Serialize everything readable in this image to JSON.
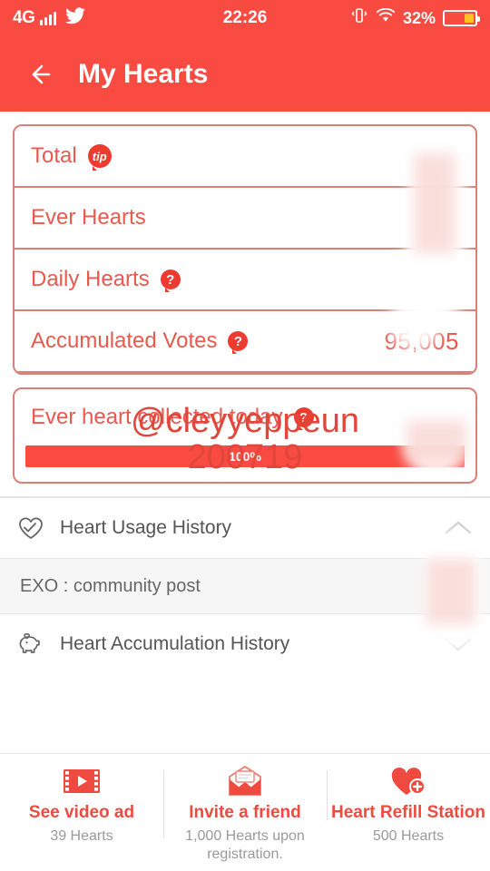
{
  "statusbar": {
    "network": "4G",
    "signal_icon": "signal-bars-icon",
    "app_icon": "twitter-bird-icon",
    "time": "22:26",
    "vibrate_icon": "vibrate-icon",
    "wifi_icon": "wifi-icon",
    "battery_percent": "32%",
    "battery_level": 32,
    "battery_color": "#ffc324"
  },
  "appbar": {
    "back_icon": "back-arrow-icon",
    "title": "My Hearts",
    "background": "#f94b41"
  },
  "summary_card": {
    "rows": [
      {
        "label": "Total",
        "badge": "tip",
        "badge_text": "tip",
        "value": ""
      },
      {
        "label": "Ever Hearts",
        "badge": "",
        "badge_text": "",
        "value": ""
      },
      {
        "label": "Daily Hearts",
        "badge": "q",
        "badge_text": "?",
        "value": ""
      },
      {
        "label": "Accumulated Votes",
        "badge": "q",
        "badge_text": "?",
        "value": "95,005"
      }
    ]
  },
  "today_card": {
    "label": "Ever heart collected today",
    "badge_text": "?",
    "value": "",
    "progress_label": "100%",
    "progress_percent": 100,
    "progress_color": "#f94b41"
  },
  "history": {
    "usage": {
      "icon": "heart-check-icon",
      "label": "Heart Usage History",
      "chevron": "chevron-up-icon",
      "expanded": true,
      "items": [
        "EXO : community post"
      ]
    },
    "accumulation": {
      "icon": "piggy-bank-heart-icon",
      "label": "Heart Accumulation History",
      "chevron": "chevron-down-icon",
      "expanded": false
    }
  },
  "bottombar": {
    "items": [
      {
        "icon": "video-ad-icon",
        "title": "See video ad",
        "sub": "39 Hearts"
      },
      {
        "icon": "envelope-icon",
        "title": "Invite a friend",
        "sub": "1,000 Hearts upon registration."
      },
      {
        "icon": "heart-plus-icon",
        "title": "Heart Refill Station",
        "sub": "500 Hearts"
      }
    ]
  },
  "watermark": {
    "line1": "@cleyyeppeun",
    "line2": "200719",
    "color": "#e0463a"
  }
}
